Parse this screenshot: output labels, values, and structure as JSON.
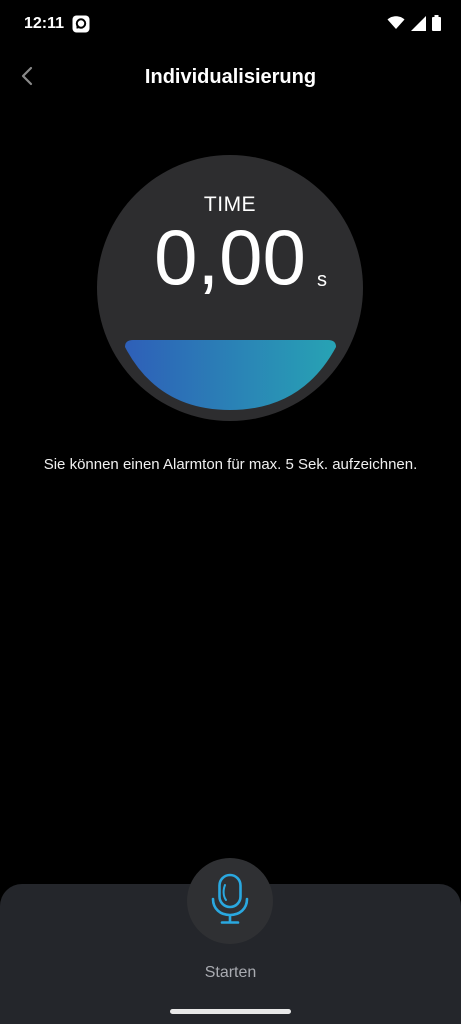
{
  "status_bar": {
    "time": "12:11",
    "icons": [
      "app-notification-icon",
      "wifi-icon",
      "cellular-signal-icon",
      "battery-icon"
    ]
  },
  "header": {
    "title": "Individualisierung",
    "back_icon": "chevron-left-icon"
  },
  "timer": {
    "label": "TIME",
    "value": "0,00",
    "unit": "s"
  },
  "info": {
    "text": "Sie können einen Alarmton für max. 5 Sek. aufzeichnen."
  },
  "recorder": {
    "mic_icon": "microphone-icon",
    "start_label": "Starten"
  },
  "colors": {
    "background": "#000000",
    "dial": "#2d2d2f",
    "gradient_start": "#2e5fb8",
    "gradient_end": "#27a3b4",
    "panel": "#24262b",
    "mic_accent": "#2aa8e0"
  }
}
